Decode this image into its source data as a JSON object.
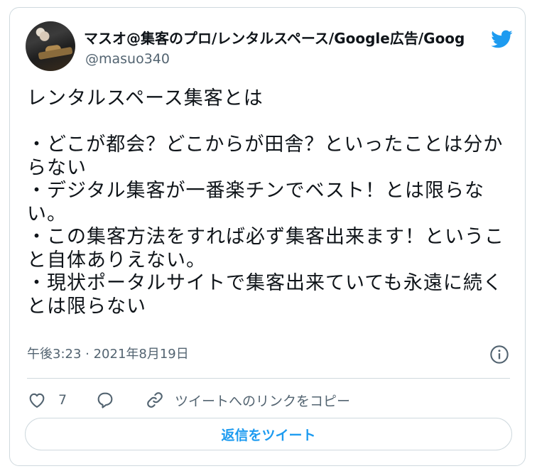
{
  "user": {
    "display_name": "マスオ@集客のプロ/レンタルスペース/Google広告/Goog",
    "handle": "@masuo340"
  },
  "tweet": {
    "text": "レンタルスペース集客とは\n\n・どこが都会？どこからが田舎？といったことは分からない\n・デジタル集客が一番楽チンでベスト！とは限らない。\n・この集客方法をすれば必ず集客出来ます！ということ自体ありえない。\n・現状ポータルサイトで集客出来ていても永遠に続くとは限らない",
    "timestamp": "午後3:23 · 2021年8月19日"
  },
  "actions": {
    "like_count": "7",
    "copy_link_label": "ツイートへのリンクをコピー"
  },
  "reply_button_label": "返信をツイート",
  "icons": {
    "brand": "twitter-bird-icon",
    "info": "info-icon",
    "like": "heart-icon",
    "reply": "reply-bubble-icon",
    "link": "link-icon"
  },
  "colors": {
    "accent": "#1d9bf0",
    "secondary_text": "#536471",
    "border": "#cfd9de"
  }
}
